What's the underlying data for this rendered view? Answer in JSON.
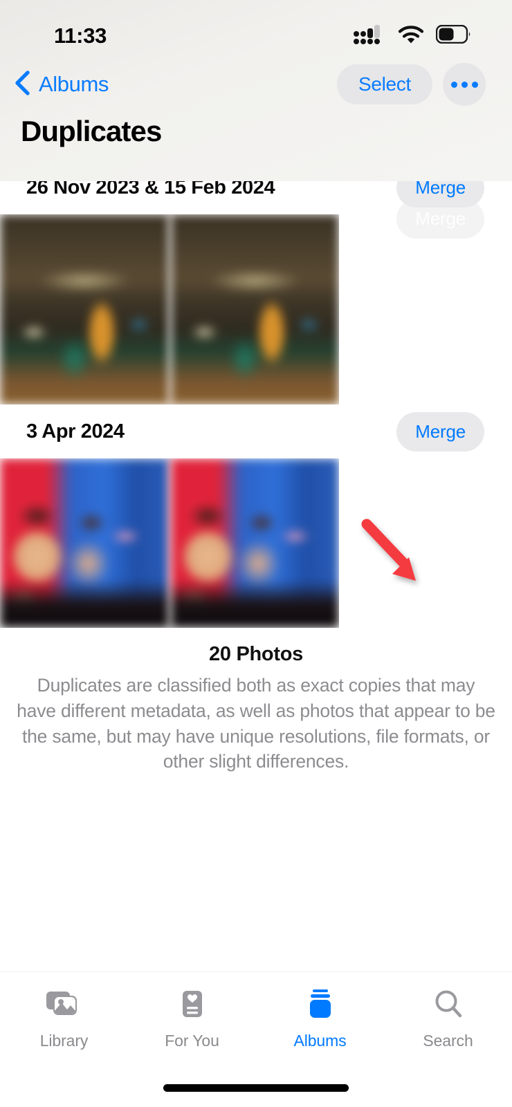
{
  "status_bar": {
    "time": "11:33",
    "cellular_icon": "cellular-signal-icon",
    "wifi_icon": "wifi-icon",
    "battery_icon": "battery-icon",
    "battery_level_pct": 52
  },
  "nav": {
    "back_label": "Albums",
    "back_icon": "chevron-left-icon",
    "select_label": "Select",
    "more_icon": "ellipsis-icon",
    "title": "Duplicates"
  },
  "colors": {
    "accent_blue": "#007AFF",
    "pill_gray": "#E9E9EB",
    "arrow_red": "#F43A3F",
    "muted_text": "#8c8c90",
    "tab_inactive": "#8a8a8e"
  },
  "groups": [
    {
      "date": "",
      "merge_label": "Merge",
      "dimmed": true,
      "theme": "dinosaur"
    },
    {
      "date": "26 Nov 2023 & 15 Feb 2024",
      "merge_label": "Merge",
      "dimmed": false,
      "theme": "restaurant"
    },
    {
      "date": "3 Apr 2024",
      "merge_label": "Merge",
      "dimmed": false,
      "theme": "selfie"
    }
  ],
  "footer": {
    "photo_count": "20 Photos",
    "description": "Duplicates are classified both as exact copies that may have different metadata, as well as photos that appear to be the same, but may have unique resolutions, file formats, or other slight differences."
  },
  "tabs": [
    {
      "label": "Library",
      "icon": "photo-stack-icon",
      "active": false
    },
    {
      "label": "For You",
      "icon": "heart-card-icon",
      "active": false
    },
    {
      "label": "Albums",
      "icon": "albums-icon",
      "active": true
    },
    {
      "label": "Search",
      "icon": "search-icon",
      "active": false
    }
  ],
  "annotation": {
    "type": "arrow",
    "points_to": "merge-button-group-3",
    "color": "#F43A3F"
  }
}
